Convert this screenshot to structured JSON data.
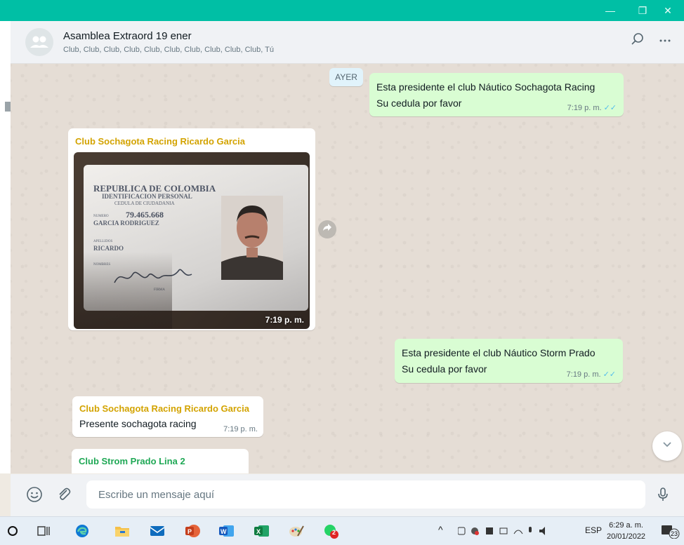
{
  "window": {
    "minimize_glyph": "—",
    "maximize_glyph": "❐",
    "close_glyph": "✕",
    "accent_color": "#00bfa5"
  },
  "chat_header": {
    "title": "Asamblea Extraord 19 ener",
    "participants": "Club, Club, Club, Club, Club, Club, Club, Club, Club, Club, Tú",
    "icons": [
      "group-avatar-icon",
      "search-icon",
      "menu-icon"
    ]
  },
  "date_chip": "AYER",
  "messages": {
    "m1": {
      "line1": "Esta presidente el club Náutico Sochagota Racing",
      "line2": "Su cedula por favor",
      "time": "7:19 p. m."
    },
    "m2": {
      "sender": "Club Sochagota Racing Ricardo Garcia",
      "sender_color": "#d3a300",
      "time": "7:19 p. m.",
      "card": {
        "country": "REPUBLICA DE COLOMBIA",
        "id_type": "IDENTIFICACION PERSONAL",
        "doc_type": "CEDULA DE CIUDADANIA",
        "numero_label": "NUMERO",
        "number": "79.465.668",
        "surnames": "GARCIA RODRIGUEZ",
        "apellidos_label": "APELLIDOS",
        "first_name": "RICARDO",
        "nombres_label": "NOMBRES",
        "firma_label": "FIRMA"
      }
    },
    "m3": {
      "line1": "Esta presidente el club Náutico Storm Prado",
      "line2": "Su cedula por favor",
      "time": "7:19 p. m."
    },
    "m4": {
      "sender": "Club Sochagota Racing Ricardo Garcia",
      "sender_color": "#d3a300",
      "text": "Presente sochagota racing",
      "time": "7:19 p. m."
    },
    "m5": {
      "sender": "Club Strom Prado Lina 2",
      "sender_color": "#1fa855"
    }
  },
  "composer": {
    "placeholder": "Escribe un mensaje aquí",
    "icons": [
      "emoji-icon",
      "attach-icon",
      "microphone-icon"
    ]
  },
  "taskbar": {
    "language": "ESP",
    "time": "6:29 a. m.",
    "date": "20/01/2022",
    "notification_count": "23",
    "app_badge": "2"
  }
}
